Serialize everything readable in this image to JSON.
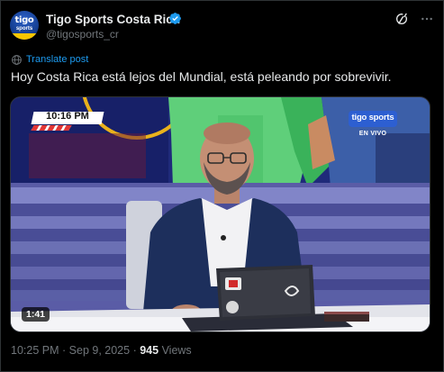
{
  "author": {
    "display_name": "Tigo Sports Costa Rica",
    "handle": "@tigosports_cr",
    "verified": true,
    "avatar_text": "tigo",
    "avatar_subtext": "sports"
  },
  "header_actions": {
    "grok_icon": "grok-slash-circle-icon",
    "more_icon": "more-dots-icon"
  },
  "translate": {
    "label": "Translate post",
    "icon": "globe-icon"
  },
  "tweet": {
    "text": "Hoy Costa Rica está lejos del Mundial, está peleando por sobrevivir."
  },
  "media": {
    "type": "video",
    "duration": "1:41",
    "scorebug_time": "10:16 PM",
    "channel_logo": "tigo sports",
    "live_label": "EN VIVO"
  },
  "footer": {
    "time": "10:25 PM",
    "separator": "·",
    "date": "Sep 9, 2025",
    "views_count": "945",
    "views_label": "Views"
  },
  "colors": {
    "background": "#000000",
    "text_primary": "#e7e9ea",
    "text_secondary": "#71767b",
    "link": "#1d9bf0",
    "verified": "#1d9bf0",
    "border": "#2f3336"
  }
}
